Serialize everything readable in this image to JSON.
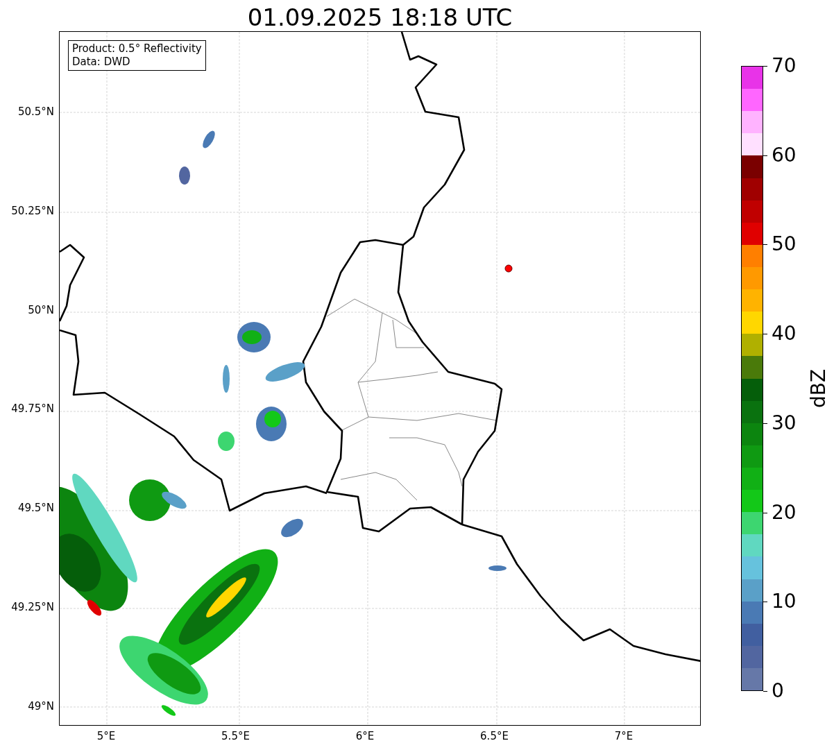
{
  "title": "01.09.2025 18:18 UTC",
  "map": {
    "info_box": [
      "Product: 0.5° Reflectivity",
      "Data: DWD"
    ],
    "lat_ticks": [
      "50.5°N",
      "50.25°N",
      "50°N",
      "49.75°N",
      "49.5°N",
      "49.25°N",
      "49°N"
    ],
    "lon_ticks": [
      "5°E",
      "5.5°E",
      "6°E",
      "6.5°E",
      "7°E"
    ]
  },
  "colorbar": {
    "label": "dBZ",
    "ticks": [
      "70",
      "60",
      "50",
      "40",
      "30",
      "20",
      "10",
      "0"
    ],
    "segments": [
      {
        "color": "#e833e8"
      },
      {
        "color": "#ff66ff"
      },
      {
        "color": "#ffb3ff"
      },
      {
        "color": "#ffe0ff"
      },
      {
        "color": "#7a0000"
      },
      {
        "color": "#a00000"
      },
      {
        "color": "#c00000"
      },
      {
        "color": "#e00000"
      },
      {
        "color": "#ff7f00"
      },
      {
        "color": "#ff9900"
      },
      {
        "color": "#ffb300"
      },
      {
        "color": "#ffd700"
      },
      {
        "color": "#b0b000"
      },
      {
        "color": "#4a7a0a"
      },
      {
        "color": "#055e0a"
      },
      {
        "color": "#0a720f"
      },
      {
        "color": "#0c850f"
      },
      {
        "color": "#0f9a12"
      },
      {
        "color": "#11b015"
      },
      {
        "color": "#13c818"
      },
      {
        "color": "#3dd670"
      },
      {
        "color": "#60d8c0"
      },
      {
        "color": "#66c2dd"
      },
      {
        "color": "#5aa0c8"
      },
      {
        "color": "#4a7ab4"
      },
      {
        "color": "#415fa0"
      },
      {
        "color": "#5266a0"
      },
      {
        "color": "#6678a8"
      }
    ]
  }
}
